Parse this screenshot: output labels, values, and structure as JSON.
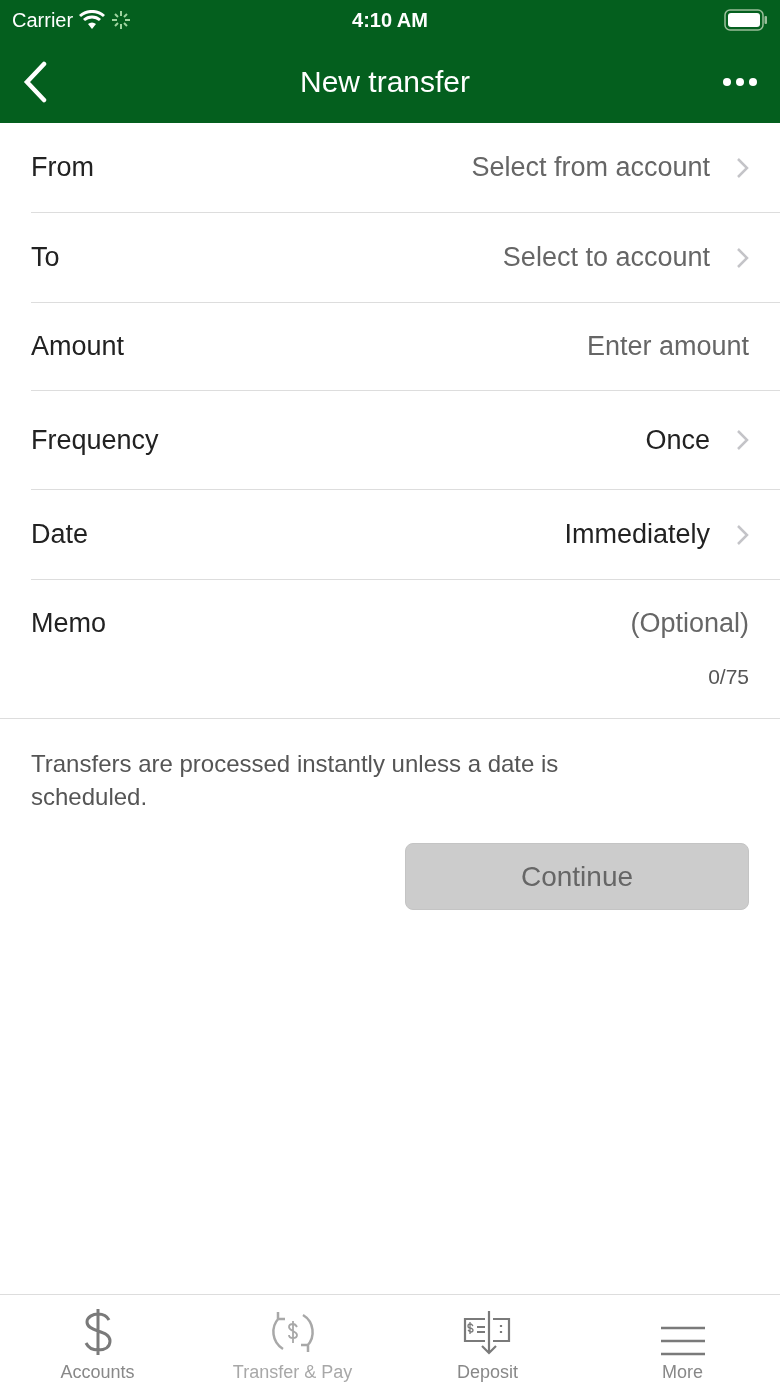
{
  "status_bar": {
    "carrier": "Carrier",
    "time": "4:10 AM"
  },
  "nav": {
    "title": "New transfer"
  },
  "fields": [
    {
      "kind": "select",
      "label": "From",
      "value": "Select from account",
      "placeholder": true
    },
    {
      "kind": "select",
      "label": "To",
      "value": "Select to account",
      "placeholder": true
    },
    {
      "kind": "input",
      "label": "Amount",
      "placeholder": "Enter amount"
    },
    {
      "kind": "select",
      "label": "Frequency",
      "value": "Once",
      "placeholder": false
    },
    {
      "kind": "select",
      "label": "Date",
      "value": "Immediately",
      "placeholder": false
    },
    {
      "kind": "memo",
      "label": "Memo",
      "placeholder": "(Optional)",
      "counter": "0/75"
    }
  ],
  "note": "Transfers are processed instantly unless a date is scheduled.",
  "continue_button": {
    "label": "Continue",
    "disabled": true
  },
  "tab_bar": [
    {
      "kind": "dollar",
      "label": "Accounts",
      "disabled": false
    },
    {
      "kind": "transfer",
      "label": "Transfer & Pay",
      "disabled": true
    },
    {
      "kind": "deposit",
      "label": "Deposit",
      "disabled": false
    },
    {
      "kind": "menu",
      "label": "More",
      "disabled": false
    }
  ]
}
